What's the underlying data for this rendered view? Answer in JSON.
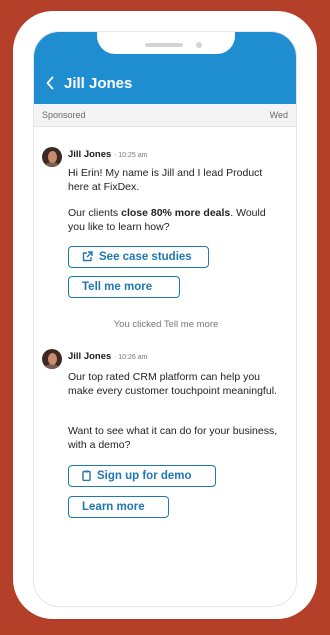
{
  "header": {
    "title": "Jill Jones"
  },
  "subbar": {
    "left": "Sponsored",
    "right": "Wed"
  },
  "messages": [
    {
      "sender": "Jill Jones",
      "time": "· 10:25 am",
      "para1": "Hi Erin! My name is Jill and I lead Product here at FixDex.",
      "para2_pre": "Our clients ",
      "para2_bold": "close 80% more deals",
      "para2_post": ". Would you like to learn how?",
      "button1": "See case studies",
      "button2": "Tell me more"
    },
    {
      "sender": "Jill Jones",
      "time": "· 10:26 am",
      "para1": "Our top rated CRM platform can help you make every customer touchpoint meaningful.",
      "para2": "Want to see what it can do for your business, with a demo?",
      "button1": "Sign up for demo",
      "button2": "Learn more"
    }
  ],
  "status": {
    "clicked": "You clicked Tell me more"
  },
  "colors": {
    "background": "#b5402a",
    "header": "#1f8ed0",
    "button": "#1f77b4"
  },
  "icons": {
    "back": "chevron-left-icon",
    "external": "external-link-icon",
    "demo": "clipboard-icon"
  }
}
